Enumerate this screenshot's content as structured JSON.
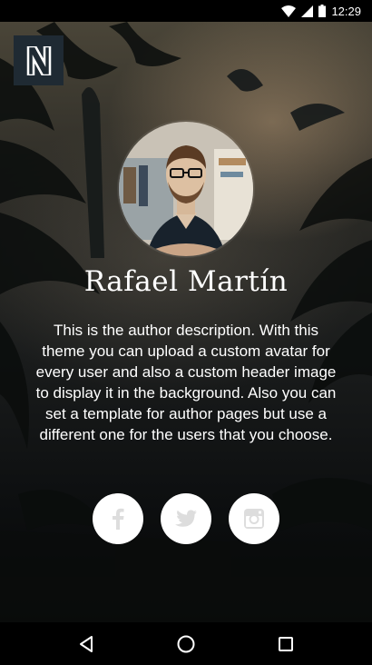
{
  "status_bar": {
    "time": "12:29",
    "icons": [
      "wifi-icon",
      "cell-signal-icon",
      "battery-icon"
    ]
  },
  "brand": {
    "logo_letter": "N",
    "logo_bg": "#1f2a33"
  },
  "author": {
    "name": "Rafael Martín",
    "description": "This is the author description. With this theme you can upload a custom avatar for every user and also a custom header image to display it in the background. Also you can set a template for author pages but use a different one for the users that you choose."
  },
  "social_links": [
    {
      "name": "facebook",
      "icon": "facebook-icon"
    },
    {
      "name": "twitter",
      "icon": "twitter-icon"
    },
    {
      "name": "instagram",
      "icon": "instagram-icon"
    }
  ],
  "nav_bar": {
    "buttons": [
      "back-icon",
      "home-icon",
      "recents-icon"
    ]
  },
  "colors": {
    "text": "#ffffff",
    "social_bg": "#ffffff",
    "social_icon": "#dddddd",
    "bars": "#000000"
  }
}
